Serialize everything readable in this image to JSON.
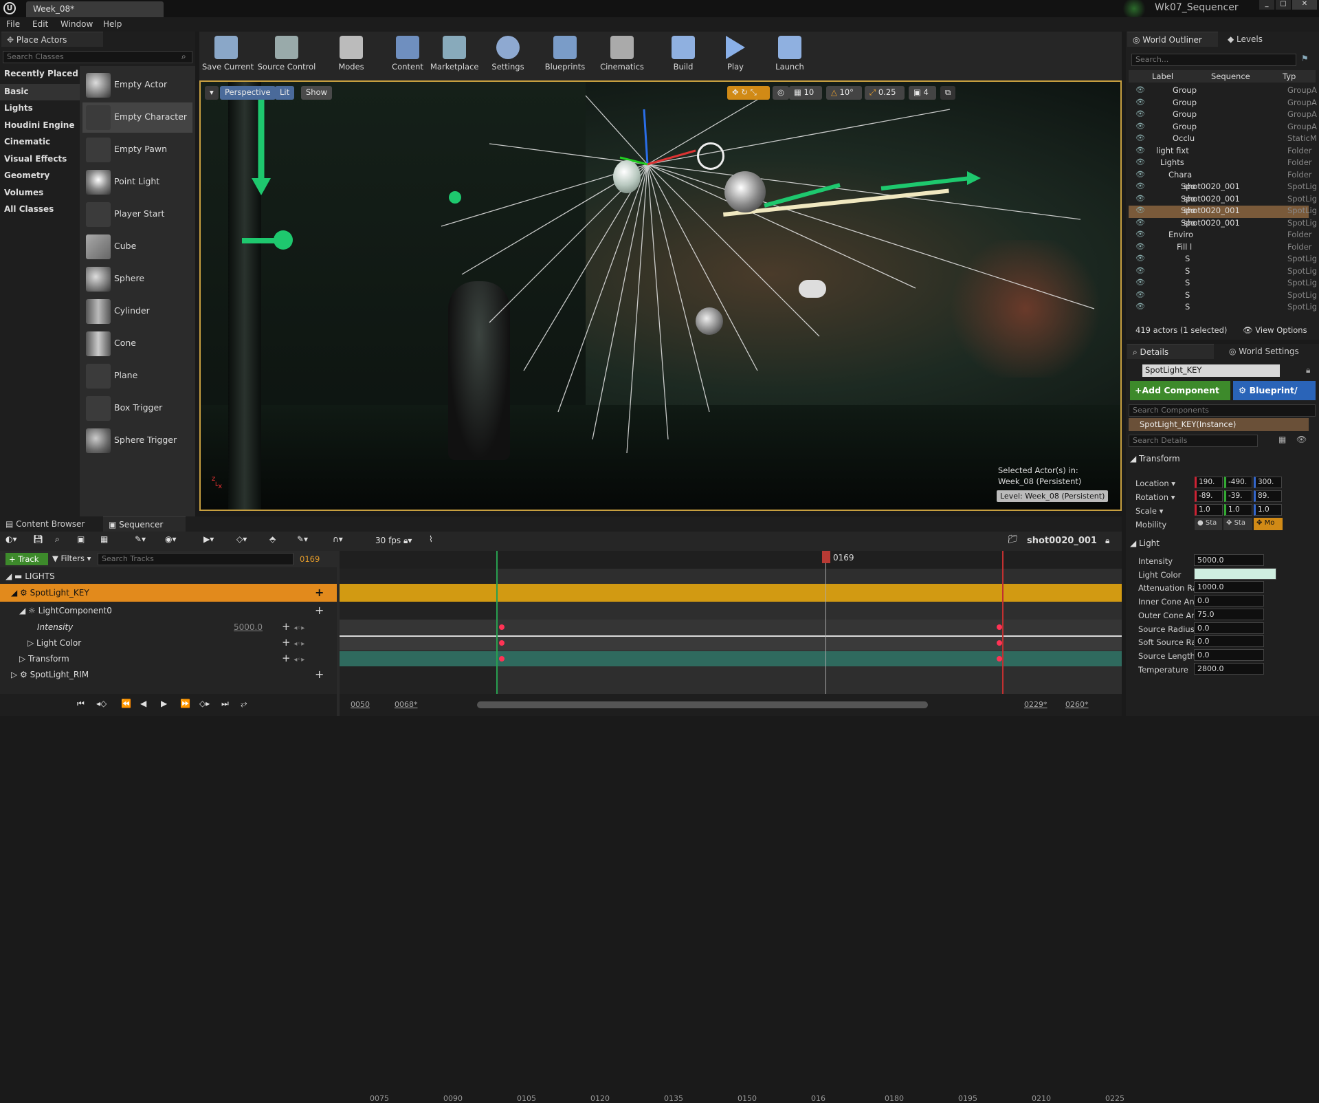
{
  "window": {
    "tab": "Week_08*",
    "project": "Wk07_Sequencer"
  },
  "menu": [
    "File",
    "Edit",
    "Window",
    "Help"
  ],
  "place_actors": {
    "tab": "Place Actors",
    "search_placeholder": "Search Classes",
    "categories": [
      "Recently Placed",
      "Basic",
      "Lights",
      "Houdini Engine",
      "Cinematic",
      "Visual Effects",
      "Geometry",
      "Volumes",
      "All Classes"
    ],
    "actors": [
      "Empty Actor",
      "Empty Character",
      "Empty Pawn",
      "Point Light",
      "Player Start",
      "Cube",
      "Sphere",
      "Cylinder",
      "Cone",
      "Plane",
      "Box Trigger",
      "Sphere Trigger"
    ]
  },
  "toolbar": [
    "Save Current",
    "Source Control",
    "Modes",
    "Content",
    "Marketplace",
    "Settings",
    "Blueprints",
    "Cinematics",
    "Build",
    "Play",
    "Launch"
  ],
  "viewport": {
    "perspective": "Perspective",
    "lit": "Lit",
    "show": "Show",
    "snap_angle": "10",
    "snap_rot": "10°",
    "snap_scale": "0.25",
    "cam_speed": "4",
    "selected_label": "Selected Actor(s) in:",
    "selected_level": "Week_08 (Persistent)",
    "level_badge": "Level:  Week_08 (Persistent)"
  },
  "outliner": {
    "tab": "World Outliner",
    "levels_tab": "Levels",
    "search_placeholder": "Search...",
    "columns": [
      "Label",
      "Sequence",
      "Typ"
    ],
    "rows": [
      {
        "name": "Group",
        "type": "GroupA"
      },
      {
        "name": "Group",
        "type": "GroupA"
      },
      {
        "name": "Group",
        "type": "GroupA"
      },
      {
        "name": "Group",
        "type": "GroupA"
      },
      {
        "name": "Occlu",
        "type": "StaticM"
      },
      {
        "name": "light fixt",
        "type": "Folder"
      },
      {
        "name": "Lights",
        "type": "Folder"
      },
      {
        "name": "Chara",
        "type": "Folder"
      },
      {
        "name": "Spo",
        "seq": "shot0020_001",
        "type": "SpotLig"
      },
      {
        "name": "Spo",
        "seq": "shot0020_001",
        "type": "SpotLig"
      },
      {
        "name": "Spo",
        "seq": "shot0020_001",
        "type": "SpotLig"
      },
      {
        "name": "Spo",
        "seq": "shot0020_001",
        "type": "SpotLig"
      },
      {
        "name": "Enviro",
        "type": "Folder"
      },
      {
        "name": "Fill l",
        "type": "Folder"
      },
      {
        "name": "S",
        "type": "SpotLig"
      },
      {
        "name": "S",
        "type": "SpotLig"
      },
      {
        "name": "S",
        "type": "SpotLig"
      },
      {
        "name": "S",
        "type": "SpotLig"
      },
      {
        "name": "S",
        "type": "SpotLig"
      }
    ],
    "footer": "419 actors (1 selected)",
    "view_options": "View Options"
  },
  "details": {
    "tab": "Details",
    "world_settings_tab": "World Settings",
    "actor_name": "SpotLight_KEY",
    "add_component": "+Add Component",
    "blueprint": "Blueprint/",
    "search_components": "Search Components",
    "instance": "SpotLight_KEY(Instance)",
    "search_details": "Search Details",
    "transform_header": "Transform",
    "location_label": "Location",
    "location": [
      "190.",
      "-490.",
      "300."
    ],
    "rotation_label": "Rotation",
    "rotation": [
      "-89.",
      "-39.",
      "89."
    ],
    "scale_label": "Scale",
    "scale": [
      "1.0",
      "1.0",
      "1.0"
    ],
    "mobility_label": "Mobility",
    "mobility": [
      "Sta",
      "Sta",
      "Mo"
    ],
    "light_header": "Light",
    "props": [
      {
        "label": "Intensity",
        "value": "5000.0"
      },
      {
        "label": "Light Color",
        "value": ""
      },
      {
        "label": "Attenuation Ra",
        "value": "1000.0"
      },
      {
        "label": "Inner Cone An",
        "value": "0.0"
      },
      {
        "label": "Outer Cone An",
        "value": "75.0"
      },
      {
        "label": "Source Radius",
        "value": "0.0"
      },
      {
        "label": "Soft Source Ra",
        "value": "0.0"
      },
      {
        "label": "Source Length",
        "value": "0.0"
      },
      {
        "label": "Temperature",
        "value": "2800.0"
      }
    ]
  },
  "bottom_tabs": [
    "Content Browser",
    "Sequencer"
  ],
  "sequencer": {
    "fps": "30 fps",
    "shot": "shot0020_001",
    "track_btn": "+ Track",
    "filters_btn": "Filters",
    "search_placeholder": "Search Tracks",
    "current_frame": "0169",
    "playhead_label": "0169",
    "tracks": [
      {
        "label": "LIGHTS",
        "value": ""
      },
      {
        "label": "SpotLight_KEY",
        "value": ""
      },
      {
        "label": "LightComponent0",
        "value": ""
      },
      {
        "label": "Intensity",
        "value": "5000.0"
      },
      {
        "label": "Light Color",
        "value": ""
      },
      {
        "label": "Transform",
        "value": ""
      },
      {
        "label": "SpotLight_RIM",
        "value": ""
      }
    ],
    "ruler": [
      "0075",
      "0090",
      "0105",
      "0120",
      "0135",
      "0150",
      "016",
      "0180",
      "0195",
      "0210",
      "0225"
    ],
    "range_start": "0050",
    "range_in": "0068*",
    "range_out": "0229*",
    "range_end": "0260*"
  },
  "colors": {
    "accent_orange": "#e28a1c",
    "section_gold": "#d29a12",
    "green_button": "#3d8a2b",
    "blue_button": "#2a64b8",
    "selection": "#4a3a28",
    "keyframe": "#ff3b4f"
  }
}
